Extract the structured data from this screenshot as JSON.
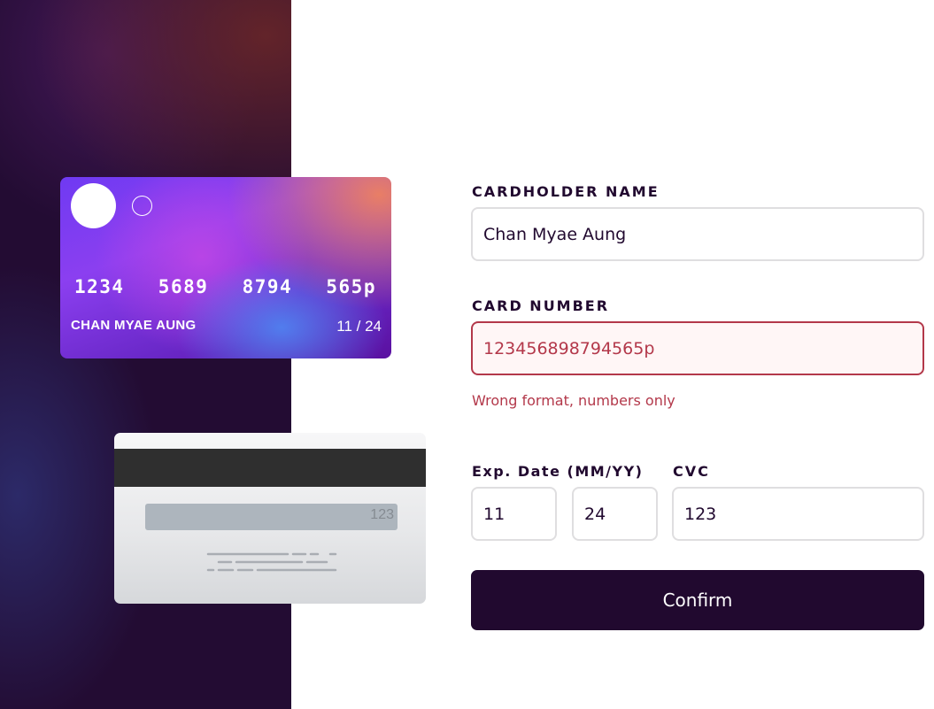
{
  "card_front": {
    "number_groups": [
      "1234",
      "5689",
      "8794",
      "565p"
    ],
    "holder": "CHAN MYAE AUNG",
    "expiry": "11 / 24"
  },
  "card_back": {
    "cvc": "123"
  },
  "form": {
    "cardholder_label": "CARDHOLDER NAME",
    "cardholder_value": "Chan Myae Aung",
    "card_number_label": "CARD NUMBER",
    "card_number_value": "123456898794565p",
    "card_number_error": "Wrong format, numbers only",
    "exp_label": "Exp. Date (MM/YY)",
    "exp_month_value": "11",
    "exp_year_value": "24",
    "cvc_label": "CVC",
    "cvc_value": "123",
    "confirm_label": "Confirm"
  },
  "colors": {
    "dark_violet": "#21092f",
    "error_red": "#b3384a",
    "input_border": "#dfdee0"
  }
}
